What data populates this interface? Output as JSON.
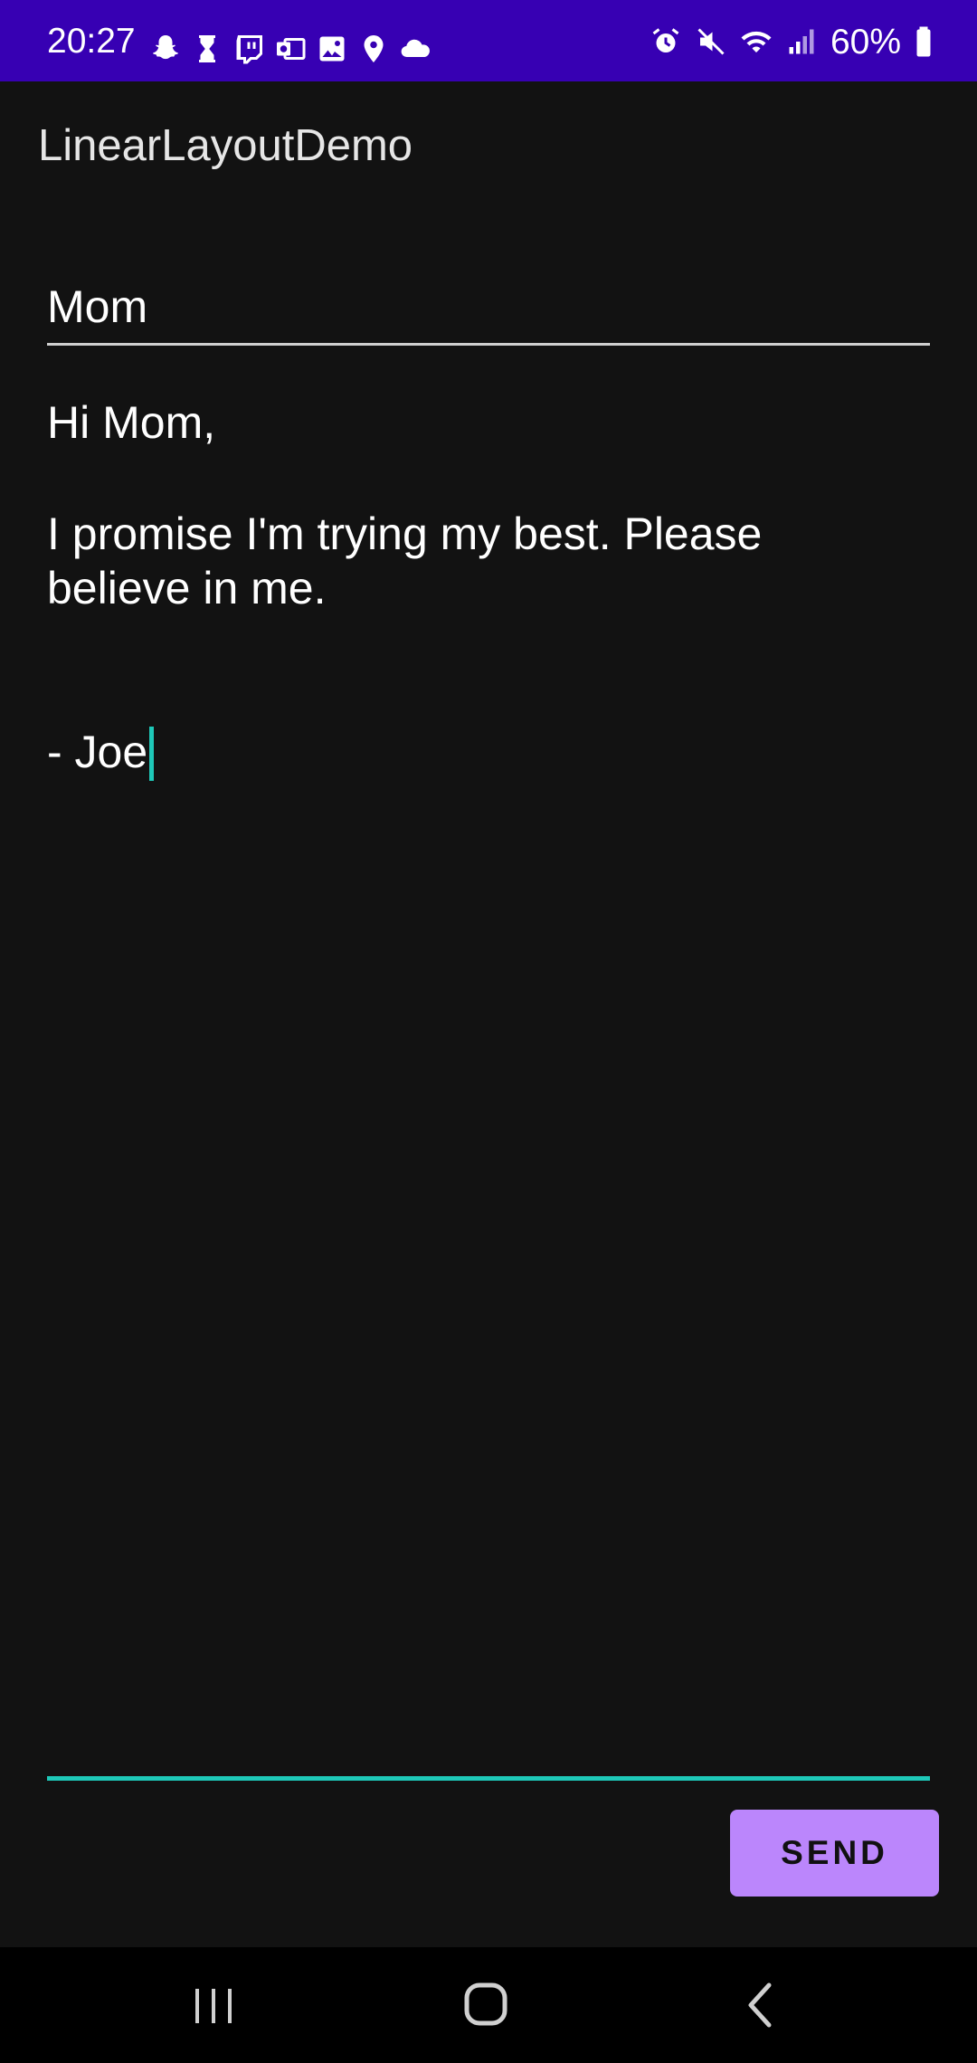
{
  "status_bar": {
    "time": "20:27",
    "battery_percent": "60%",
    "background_color": "#3700b3",
    "left_icons": [
      "snapchat-icon",
      "hourglass-icon",
      "twitch-icon",
      "outlook-icon",
      "gallery-icon",
      "location-icon",
      "cloud-icon"
    ],
    "right_icons": [
      "alarm-icon",
      "mute-icon",
      "wifi-icon",
      "signal-icon",
      "battery-icon"
    ]
  },
  "app": {
    "title": "LinearLayoutDemo"
  },
  "form": {
    "to_value": "Mom",
    "message_lines": [
      "Hi Mom,",
      "",
      "I promise I'm trying my best. Please",
      "believe in me.",
      "",
      "",
      "- Joe"
    ],
    "send_label": "SEND",
    "accent_color": "#1ec8b8",
    "button_color": "#bb86fc"
  },
  "nav_bar": {
    "icons": [
      "recents-icon",
      "home-icon",
      "back-icon"
    ]
  }
}
